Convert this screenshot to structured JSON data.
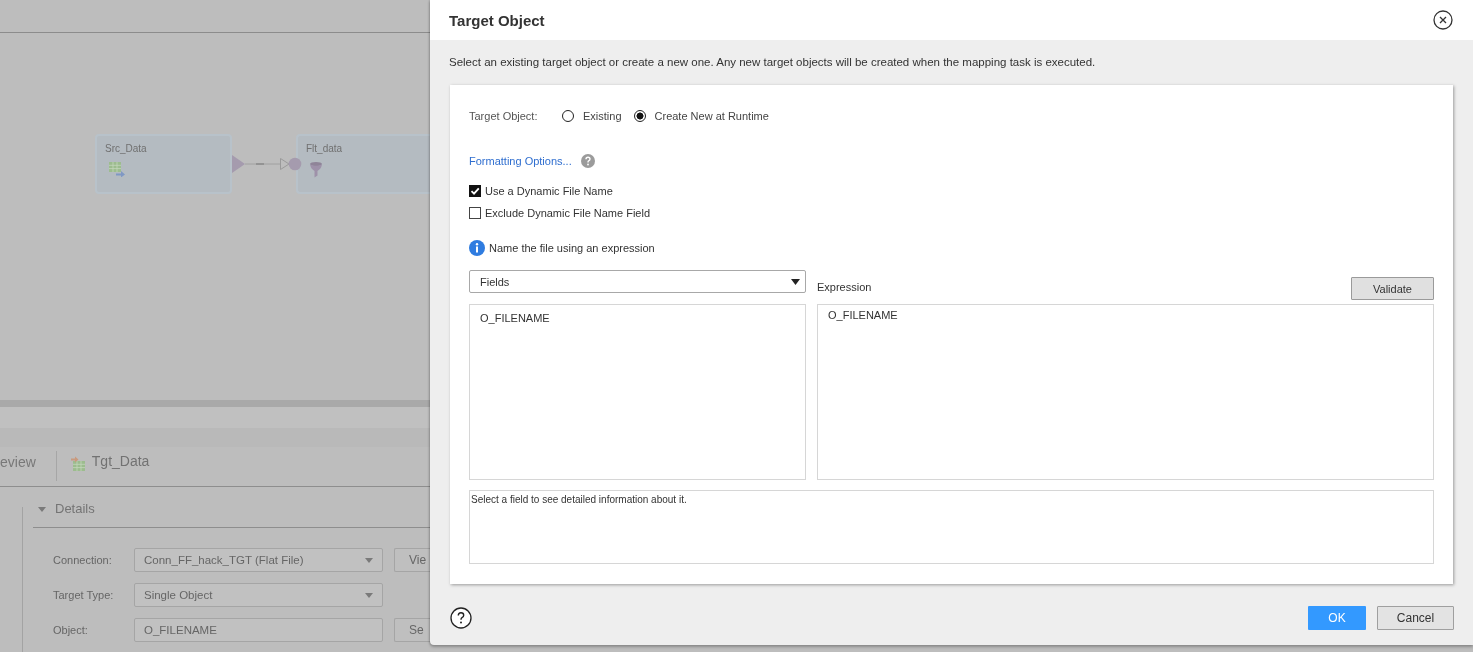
{
  "background": {
    "canvas": {
      "nodes": [
        {
          "label": "Src_Data",
          "kind": "source"
        },
        {
          "label": "Flt_data",
          "kind": "filter"
        }
      ]
    },
    "panel": {
      "tab": "eview",
      "object": {
        "label": "Tgt_Data",
        "kind": "target"
      }
    },
    "details": {
      "title": "Details",
      "expanded": true,
      "fields": [
        {
          "label": "Connection:",
          "kind": "select",
          "value": "Conn_FF_hack_TGT (Flat File)",
          "button": "Vie"
        },
        {
          "label": "Target Type:",
          "kind": "select",
          "value": "Single Object"
        },
        {
          "label": "Object:",
          "kind": "input",
          "value": "O_FILENAME",
          "button": "Se"
        }
      ]
    }
  },
  "dialog": {
    "title": "Target Object",
    "description": "Select an existing target object or create a new one. Any new target objects will be created when the mapping task is executed.",
    "target_object": {
      "label": "Target Object:",
      "options": [
        {
          "label": "Existing",
          "selected": false
        },
        {
          "label": "Create New at Runtime",
          "selected": true
        }
      ]
    },
    "formatting_link": "Formatting Options...",
    "checkboxes": [
      {
        "label": "Use a Dynamic File Name",
        "checked": true
      },
      {
        "label": "Exclude Dynamic File Name Field",
        "checked": false
      }
    ],
    "info": "Name the file using an expression",
    "fields_select": {
      "value": "Fields"
    },
    "fields_list": [
      {
        "label": "O_FILENAME",
        "selected": false
      }
    ],
    "expression": {
      "label": "Expression",
      "value": "O_FILENAME"
    },
    "validate_button": "Validate",
    "field_description": "Select a field to see detailed information about it.",
    "buttons": [
      {
        "label": "OK",
        "kind": "primary"
      },
      {
        "label": "Cancel",
        "kind": "secondary"
      }
    ]
  }
}
